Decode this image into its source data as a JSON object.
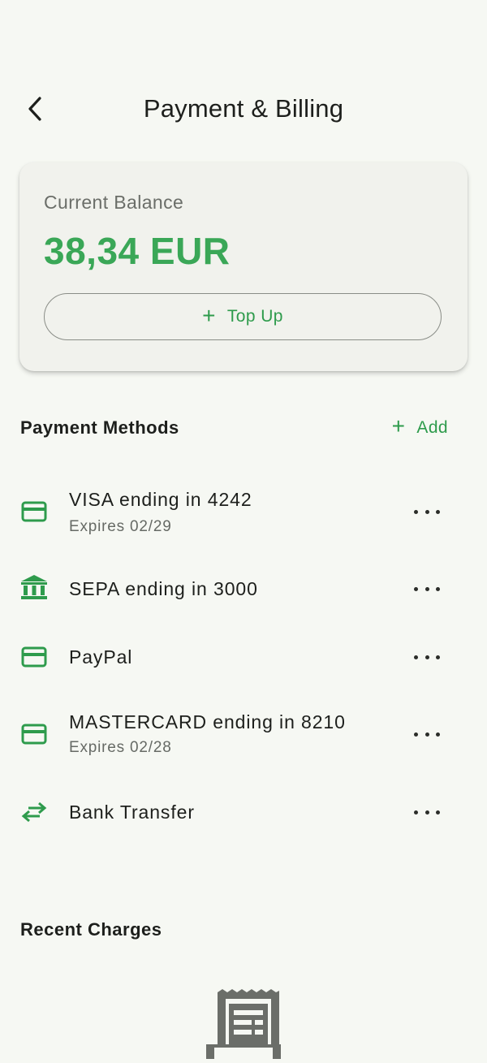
{
  "header": {
    "title": "Payment & Billing"
  },
  "balance": {
    "label": "Current Balance",
    "amount": "38,34 EUR",
    "topup_label": "Top Up"
  },
  "payment_methods": {
    "title": "Payment Methods",
    "add_label": "Add",
    "items": [
      {
        "title": "VISA ending in 4242",
        "subtitle": "Expires 02/29",
        "icon": "credit-card-icon"
      },
      {
        "title": "SEPA ending in 3000",
        "subtitle": "",
        "icon": "bank-icon"
      },
      {
        "title": "PayPal",
        "subtitle": "",
        "icon": "credit-card-icon"
      },
      {
        "title": "MASTERCARD ending in 8210",
        "subtitle": "Expires 02/28",
        "icon": "credit-card-icon"
      },
      {
        "title": "Bank Transfer",
        "subtitle": "",
        "icon": "transfer-arrows-icon"
      }
    ]
  },
  "recent_charges": {
    "title": "Recent Charges",
    "empty_icon": "receipt-icon"
  },
  "colors": {
    "accent": "#2e9b4c",
    "amount": "#3aa757",
    "background": "#f6f8f3",
    "card": "#f1f2ed",
    "icon_gray": "#6b6e69"
  }
}
